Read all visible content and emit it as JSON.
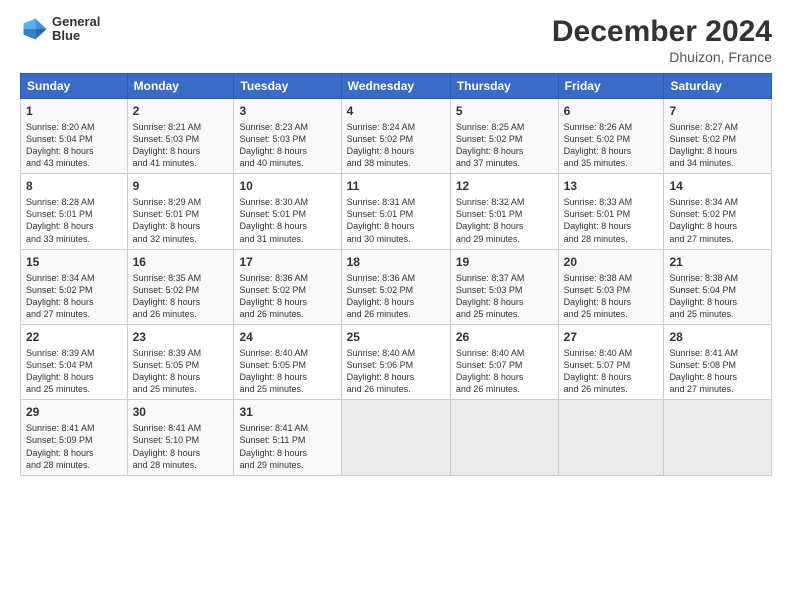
{
  "header": {
    "logo_line1": "General",
    "logo_line2": "Blue",
    "month_title": "December 2024",
    "location": "Dhuizon, France"
  },
  "days_of_week": [
    "Sunday",
    "Monday",
    "Tuesday",
    "Wednesday",
    "Thursday",
    "Friday",
    "Saturday"
  ],
  "weeks": [
    [
      {
        "day": "1",
        "info": "Sunrise: 8:20 AM\nSunset: 5:04 PM\nDaylight: 8 hours\nand 43 minutes."
      },
      {
        "day": "2",
        "info": "Sunrise: 8:21 AM\nSunset: 5:03 PM\nDaylight: 8 hours\nand 41 minutes."
      },
      {
        "day": "3",
        "info": "Sunrise: 8:23 AM\nSunset: 5:03 PM\nDaylight: 8 hours\nand 40 minutes."
      },
      {
        "day": "4",
        "info": "Sunrise: 8:24 AM\nSunset: 5:02 PM\nDaylight: 8 hours\nand 38 minutes."
      },
      {
        "day": "5",
        "info": "Sunrise: 8:25 AM\nSunset: 5:02 PM\nDaylight: 8 hours\nand 37 minutes."
      },
      {
        "day": "6",
        "info": "Sunrise: 8:26 AM\nSunset: 5:02 PM\nDaylight: 8 hours\nand 35 minutes."
      },
      {
        "day": "7",
        "info": "Sunrise: 8:27 AM\nSunset: 5:02 PM\nDaylight: 8 hours\nand 34 minutes."
      }
    ],
    [
      {
        "day": "8",
        "info": "Sunrise: 8:28 AM\nSunset: 5:01 PM\nDaylight: 8 hours\nand 33 minutes."
      },
      {
        "day": "9",
        "info": "Sunrise: 8:29 AM\nSunset: 5:01 PM\nDaylight: 8 hours\nand 32 minutes."
      },
      {
        "day": "10",
        "info": "Sunrise: 8:30 AM\nSunset: 5:01 PM\nDaylight: 8 hours\nand 31 minutes."
      },
      {
        "day": "11",
        "info": "Sunrise: 8:31 AM\nSunset: 5:01 PM\nDaylight: 8 hours\nand 30 minutes."
      },
      {
        "day": "12",
        "info": "Sunrise: 8:32 AM\nSunset: 5:01 PM\nDaylight: 8 hours\nand 29 minutes."
      },
      {
        "day": "13",
        "info": "Sunrise: 8:33 AM\nSunset: 5:01 PM\nDaylight: 8 hours\nand 28 minutes."
      },
      {
        "day": "14",
        "info": "Sunrise: 8:34 AM\nSunset: 5:02 PM\nDaylight: 8 hours\nand 27 minutes."
      }
    ],
    [
      {
        "day": "15",
        "info": "Sunrise: 8:34 AM\nSunset: 5:02 PM\nDaylight: 8 hours\nand 27 minutes."
      },
      {
        "day": "16",
        "info": "Sunrise: 8:35 AM\nSunset: 5:02 PM\nDaylight: 8 hours\nand 26 minutes."
      },
      {
        "day": "17",
        "info": "Sunrise: 8:36 AM\nSunset: 5:02 PM\nDaylight: 8 hours\nand 26 minutes."
      },
      {
        "day": "18",
        "info": "Sunrise: 8:36 AM\nSunset: 5:02 PM\nDaylight: 8 hours\nand 26 minutes."
      },
      {
        "day": "19",
        "info": "Sunrise: 8:37 AM\nSunset: 5:03 PM\nDaylight: 8 hours\nand 25 minutes."
      },
      {
        "day": "20",
        "info": "Sunrise: 8:38 AM\nSunset: 5:03 PM\nDaylight: 8 hours\nand 25 minutes."
      },
      {
        "day": "21",
        "info": "Sunrise: 8:38 AM\nSunset: 5:04 PM\nDaylight: 8 hours\nand 25 minutes."
      }
    ],
    [
      {
        "day": "22",
        "info": "Sunrise: 8:39 AM\nSunset: 5:04 PM\nDaylight: 8 hours\nand 25 minutes."
      },
      {
        "day": "23",
        "info": "Sunrise: 8:39 AM\nSunset: 5:05 PM\nDaylight: 8 hours\nand 25 minutes."
      },
      {
        "day": "24",
        "info": "Sunrise: 8:40 AM\nSunset: 5:05 PM\nDaylight: 8 hours\nand 25 minutes."
      },
      {
        "day": "25",
        "info": "Sunrise: 8:40 AM\nSunset: 5:06 PM\nDaylight: 8 hours\nand 26 minutes."
      },
      {
        "day": "26",
        "info": "Sunrise: 8:40 AM\nSunset: 5:07 PM\nDaylight: 8 hours\nand 26 minutes."
      },
      {
        "day": "27",
        "info": "Sunrise: 8:40 AM\nSunset: 5:07 PM\nDaylight: 8 hours\nand 26 minutes."
      },
      {
        "day": "28",
        "info": "Sunrise: 8:41 AM\nSunset: 5:08 PM\nDaylight: 8 hours\nand 27 minutes."
      }
    ],
    [
      {
        "day": "29",
        "info": "Sunrise: 8:41 AM\nSunset: 5:09 PM\nDaylight: 8 hours\nand 28 minutes."
      },
      {
        "day": "30",
        "info": "Sunrise: 8:41 AM\nSunset: 5:10 PM\nDaylight: 8 hours\nand 28 minutes."
      },
      {
        "day": "31",
        "info": "Sunrise: 8:41 AM\nSunset: 5:11 PM\nDaylight: 8 hours\nand 29 minutes."
      },
      {
        "day": "",
        "info": ""
      },
      {
        "day": "",
        "info": ""
      },
      {
        "day": "",
        "info": ""
      },
      {
        "day": "",
        "info": ""
      }
    ]
  ]
}
